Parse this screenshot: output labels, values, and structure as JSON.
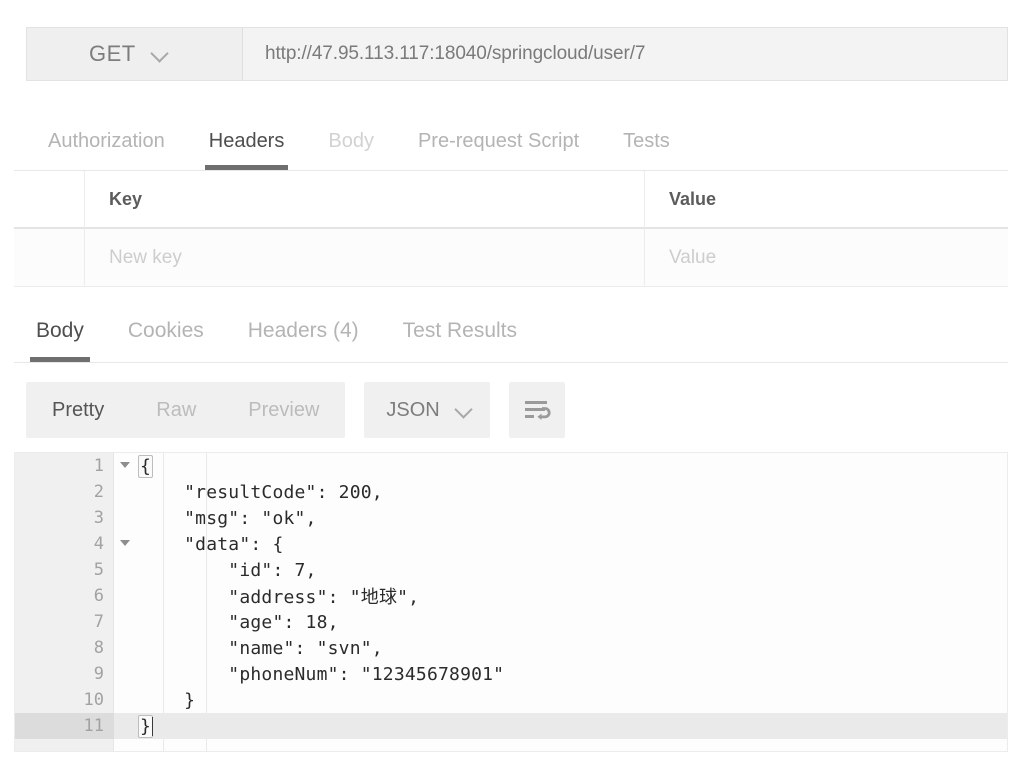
{
  "request": {
    "method": "GET",
    "method_dropdown_icon": "chevron-down-icon",
    "url": "http://47.95.113.117:18040/springcloud/user/7",
    "tabs": [
      {
        "label": "Authorization",
        "state": "inactive"
      },
      {
        "label": "Headers",
        "state": "active"
      },
      {
        "label": "Body",
        "state": "disabled"
      },
      {
        "label": "Pre-request Script",
        "state": "inactive"
      },
      {
        "label": "Tests",
        "state": "inactive"
      }
    ]
  },
  "headers_table": {
    "columns": {
      "key": "Key",
      "value": "Value"
    },
    "new_row": {
      "key_placeholder": "New key",
      "value_placeholder": "Value"
    }
  },
  "response": {
    "tabs": [
      {
        "label": "Body",
        "state": "active"
      },
      {
        "label": "Cookies",
        "state": "inactive"
      },
      {
        "label": "Headers (4)",
        "state": "inactive"
      },
      {
        "label": "Test Results",
        "state": "inactive"
      }
    ],
    "view_modes": [
      {
        "label": "Pretty",
        "state": "active"
      },
      {
        "label": "Raw",
        "state": "inactive"
      },
      {
        "label": "Preview",
        "state": "inactive"
      }
    ],
    "format": {
      "selected": "JSON",
      "dropdown_icon": "chevron-down-icon"
    },
    "wrap_button_icon": "word-wrap-icon",
    "body_lines": [
      {
        "num": "1",
        "text": "{",
        "fold": true,
        "current": false,
        "brace": "open"
      },
      {
        "num": "2",
        "text": "    \"resultCode\": 200,",
        "fold": false,
        "current": false
      },
      {
        "num": "3",
        "text": "    \"msg\": \"ok\",",
        "fold": false,
        "current": false
      },
      {
        "num": "4",
        "text": "    \"data\": {",
        "fold": true,
        "current": false
      },
      {
        "num": "5",
        "text": "        \"id\": 7,",
        "fold": false,
        "current": false
      },
      {
        "num": "6",
        "text": "        \"address\": \"地球\",",
        "fold": false,
        "current": false
      },
      {
        "num": "7",
        "text": "        \"age\": 18,",
        "fold": false,
        "current": false
      },
      {
        "num": "8",
        "text": "        \"name\": \"svn\",",
        "fold": false,
        "current": false
      },
      {
        "num": "9",
        "text": "        \"phoneNum\": \"12345678901\"",
        "fold": false,
        "current": false
      },
      {
        "num": "10",
        "text": "    }",
        "fold": false,
        "current": false
      },
      {
        "num": "11",
        "text": "}",
        "fold": false,
        "current": true,
        "brace": "close"
      }
    ]
  }
}
